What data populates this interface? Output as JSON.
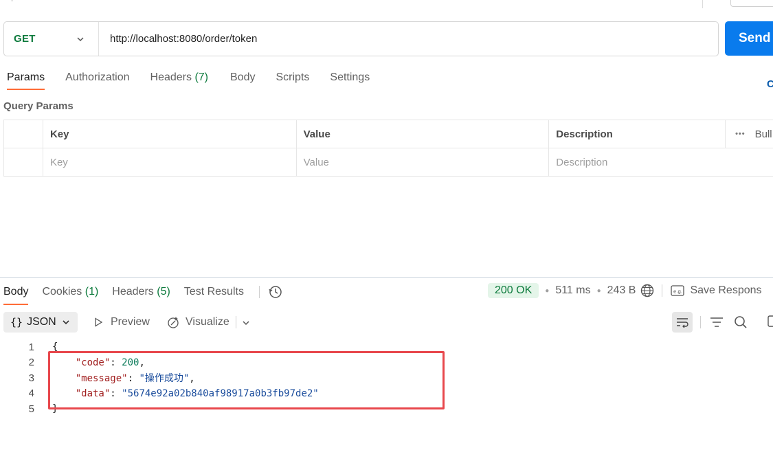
{
  "request": {
    "method": "GET",
    "url": "http://localhost:8080/order/token",
    "send_label": "Send"
  },
  "request_tabs": [
    {
      "label": "Params",
      "count": ""
    },
    {
      "label": "Authorization",
      "count": ""
    },
    {
      "label": "Headers",
      "count": "(7)"
    },
    {
      "label": "Body",
      "count": ""
    },
    {
      "label": "Scripts",
      "count": ""
    },
    {
      "label": "Settings",
      "count": ""
    }
  ],
  "cookies_link": "C",
  "query_params": {
    "title": "Query Params",
    "headers": {
      "key": "Key",
      "value": "Value",
      "description": "Description",
      "bulk": "Bull"
    },
    "placeholders": {
      "key": "Key",
      "value": "Value",
      "description": "Description"
    }
  },
  "response_tabs": [
    {
      "label": "Body",
      "count": ""
    },
    {
      "label": "Cookies",
      "count": "(1)"
    },
    {
      "label": "Headers",
      "count": "(5)"
    },
    {
      "label": "Test Results",
      "count": ""
    }
  ],
  "response_meta": {
    "status": "200 OK",
    "time": "511 ms",
    "size": "243 B",
    "save_label": "Save Respons"
  },
  "response_toolbar": {
    "format": "JSON",
    "preview": "Preview",
    "visualize": "Visualize"
  },
  "code_lines": [
    {
      "num": "1",
      "text": "{"
    },
    {
      "num": "2",
      "key": "\"code\"",
      "value": "200",
      "value_type": "n",
      "trail": ","
    },
    {
      "num": "3",
      "key": "\"message\"",
      "value": "\"操作成功\"",
      "value_type": "s",
      "trail": ","
    },
    {
      "num": "4",
      "key": "\"data\"",
      "value": "\"5674e92a02b840af98917a0b3fb97de2\"",
      "value_type": "s",
      "trail": ""
    },
    {
      "num": "5",
      "text": "}"
    }
  ],
  "colors": {
    "method_get": "#0c7a3c",
    "send_button": "#097bed",
    "active_tab_underline": "#ff6c37",
    "status_ok_bg": "#e4f5e9",
    "highlight_box": "#e8474c"
  }
}
